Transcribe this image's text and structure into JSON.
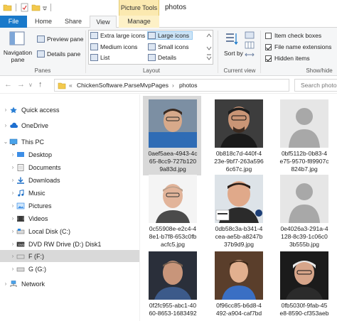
{
  "window": {
    "title": "photos",
    "context_tab_title": "Picture Tools"
  },
  "tabs": [
    {
      "label": "File"
    },
    {
      "label": "Home"
    },
    {
      "label": "Share"
    },
    {
      "label": "View"
    },
    {
      "label": "Manage"
    }
  ],
  "ribbon": {
    "panes": {
      "label": "Panes",
      "navigation_pane": "Navigation pane",
      "preview_pane": "Preview pane",
      "details_pane": "Details pane"
    },
    "layout": {
      "label": "Layout",
      "options": [
        "Extra large icons",
        "Large icons",
        "Medium icons",
        "Small icons",
        "List",
        "Details"
      ],
      "selected": "Large icons"
    },
    "current_view": {
      "label": "Current view",
      "sort_by": "Sort by"
    },
    "show_hide": {
      "label": "Show/hide",
      "item_check_boxes": "Item check boxes",
      "file_name_extensions": "File name extensions",
      "hidden_items": "Hidden items",
      "item_check_boxes_checked": false,
      "file_name_extensions_checked": true,
      "hidden_items_checked": true
    }
  },
  "address": {
    "chevron": "«",
    "segments": [
      "ChickenSoftware.ParseMvpPages",
      "photos"
    ],
    "search_placeholder": "Search photo"
  },
  "nav": [
    {
      "label": "Quick access",
      "icon": "star-icon",
      "expand": ">"
    },
    {
      "label": "OneDrive",
      "icon": "cloud-icon",
      "expand": ">"
    },
    {
      "label": "This PC",
      "icon": "monitor-icon",
      "expand": "v"
    },
    {
      "label": "Desktop",
      "icon": "desktop-folder-icon",
      "expand": ">"
    },
    {
      "label": "Documents",
      "icon": "documents-folder-icon",
      "expand": ">"
    },
    {
      "label": "Downloads",
      "icon": "downloads-folder-icon",
      "expand": ">"
    },
    {
      "label": "Music",
      "icon": "music-folder-icon",
      "expand": ">"
    },
    {
      "label": "Pictures",
      "icon": "pictures-folder-icon",
      "expand": ">"
    },
    {
      "label": "Videos",
      "icon": "videos-folder-icon",
      "expand": ">"
    },
    {
      "label": "Local Disk (C:)",
      "icon": "drive-icon",
      "expand": ">"
    },
    {
      "label": "DVD RW Drive (D:) Disk1",
      "icon": "dvd-drive-icon",
      "expand": ">"
    },
    {
      "label": "F (F:)",
      "icon": "drive-icon",
      "expand": ">"
    },
    {
      "label": "G (G:)",
      "icon": "drive-icon",
      "expand": ">"
    },
    {
      "label": "Network",
      "icon": "network-icon",
      "expand": ">"
    }
  ],
  "files": [
    {
      "line1": "0aef5aea-4943-4c",
      "line2": "65-8cc9-727b120",
      "line3": "9a83d.jpg",
      "kind": "photo",
      "palette": "blue-shirt"
    },
    {
      "line1": "0b818c7d-440f-4",
      "line2": "23e-9bf7-263a596",
      "line3": "6c67c.jpg",
      "kind": "photo",
      "palette": "dark-shirt"
    },
    {
      "line1": "0bf5112b-0b83-4",
      "line2": "e75-9570-f89907c",
      "line3": "824b7.jpg",
      "kind": "placeholder"
    },
    {
      "line1": "0c55908e-e2c4-4",
      "line2": "8e1-b7f8-653c0fb",
      "line3": "acfc5.jpg",
      "kind": "photo",
      "palette": "white-bg"
    },
    {
      "line1": "0db58c3a-b341-4",
      "line2": "cea-ae5b-a8247b",
      "line3": "37b9d9.jpg",
      "kind": "photo",
      "palette": "mvp-badge"
    },
    {
      "line1": "0e4026a3-291a-4",
      "line2": "128-8c39-1c06c0",
      "line3": "3b555b.jpg",
      "kind": "placeholder"
    },
    {
      "line1": "0f2fc955-abc1-40",
      "line2": "60-8653-1683492",
      "line3": "",
      "kind": "photo",
      "palette": "dark-bg"
    },
    {
      "line1": "0f96cc85-b6d8-4",
      "line2": "492-a904-caf7bd",
      "line3": "",
      "kind": "photo",
      "palette": "brown-bg"
    },
    {
      "line1": "0fb5030f-9fab-45",
      "line2": "e8-8590-cf353aeb",
      "line3": "",
      "kind": "photo",
      "palette": "grey-hair"
    }
  ],
  "colors": {
    "accent": "#1979ca",
    "context_tab": "#fbe9b0",
    "selection": "#d9d9d9",
    "ribbon_bg": "#f5f6f7"
  }
}
